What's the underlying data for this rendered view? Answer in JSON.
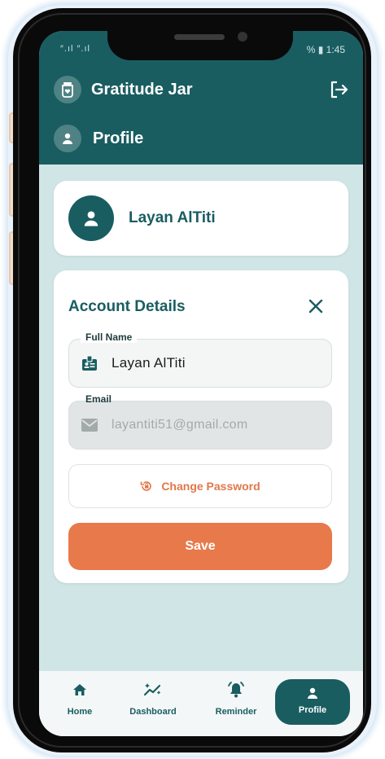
{
  "status": {
    "left": "″.ıl ″.ıl",
    "right": "% ▮ 1:45"
  },
  "header": {
    "app_title": "Gratitude Jar",
    "page_title": "Profile"
  },
  "user": {
    "name": "Layan AlTiti"
  },
  "account": {
    "title": "Account Details",
    "full_name_label": "Full Name",
    "full_name_value": "Layan AlTiti",
    "email_label": "Email",
    "email_value": "layantiti51@gmail.com",
    "change_password": "Change Password",
    "save": "Save"
  },
  "nav": {
    "items": [
      {
        "label": "Home",
        "icon": "home-icon"
      },
      {
        "label": "Dashboard",
        "icon": "dashboard-icon"
      },
      {
        "label": "Reminder",
        "icon": "bell-icon"
      },
      {
        "label": "Profile",
        "icon": "person-icon"
      }
    ],
    "active": "Profile"
  },
  "colors": {
    "primary": "#195d61",
    "accent": "#e8794a",
    "background": "#d0e5e6"
  }
}
